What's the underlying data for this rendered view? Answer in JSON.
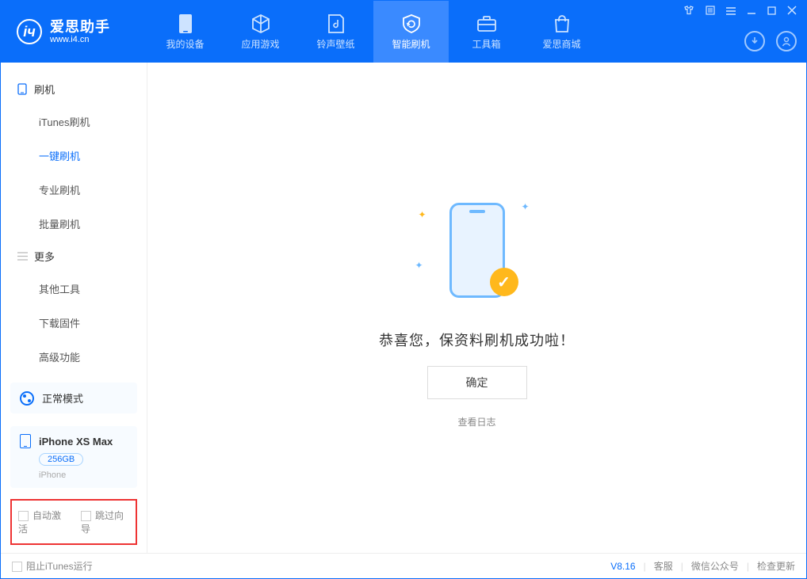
{
  "app": {
    "name": "爱思助手",
    "url": "www.i4.cn"
  },
  "nav": {
    "items": [
      {
        "label": "我的设备"
      },
      {
        "label": "应用游戏"
      },
      {
        "label": "铃声壁纸"
      },
      {
        "label": "智能刷机"
      },
      {
        "label": "工具箱"
      },
      {
        "label": "爱思商城"
      }
    ]
  },
  "sidebar": {
    "group_flash": "刷机",
    "flash_items": [
      "iTunes刷机",
      "一键刷机",
      "专业刷机",
      "批量刷机"
    ],
    "group_more": "更多",
    "more_items": [
      "其他工具",
      "下载固件",
      "高级功能"
    ],
    "mode_label": "正常模式",
    "device": {
      "name": "iPhone XS Max",
      "capacity": "256GB",
      "type": "iPhone"
    },
    "cb_auto_activate": "自动激活",
    "cb_skip_wizard": "跳过向导"
  },
  "main": {
    "success_text": "恭喜您，保资料刷机成功啦！",
    "ok_button": "确定",
    "view_log": "查看日志"
  },
  "footer": {
    "block_itunes": "阻止iTunes运行",
    "version": "V8.16",
    "links": [
      "客服",
      "微信公众号",
      "检查更新"
    ]
  }
}
